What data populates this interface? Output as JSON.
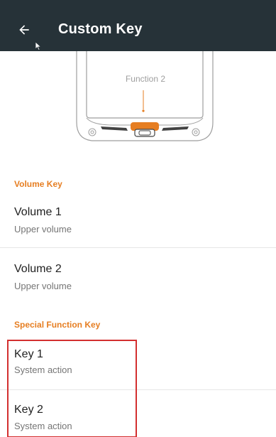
{
  "toolbar": {
    "title": "Custom Key",
    "back_icon": "arrow-back-icon",
    "background": "#263238"
  },
  "illustration": {
    "function_label": "Function 2",
    "accent": "#e67e22"
  },
  "sections": {
    "volume_key": {
      "header": "Volume Key",
      "items": [
        {
          "title": "Volume 1",
          "summary": "Upper volume"
        },
        {
          "title": "Volume 2",
          "summary": "Upper volume"
        }
      ]
    },
    "special_function_key": {
      "header": "Special Function Key",
      "items": [
        {
          "title": "Key 1",
          "summary": "System action"
        },
        {
          "title": "Key 2",
          "summary": "System action"
        }
      ]
    }
  },
  "colors": {
    "section_header": "#e67e22",
    "highlight": "#d32f2f"
  }
}
